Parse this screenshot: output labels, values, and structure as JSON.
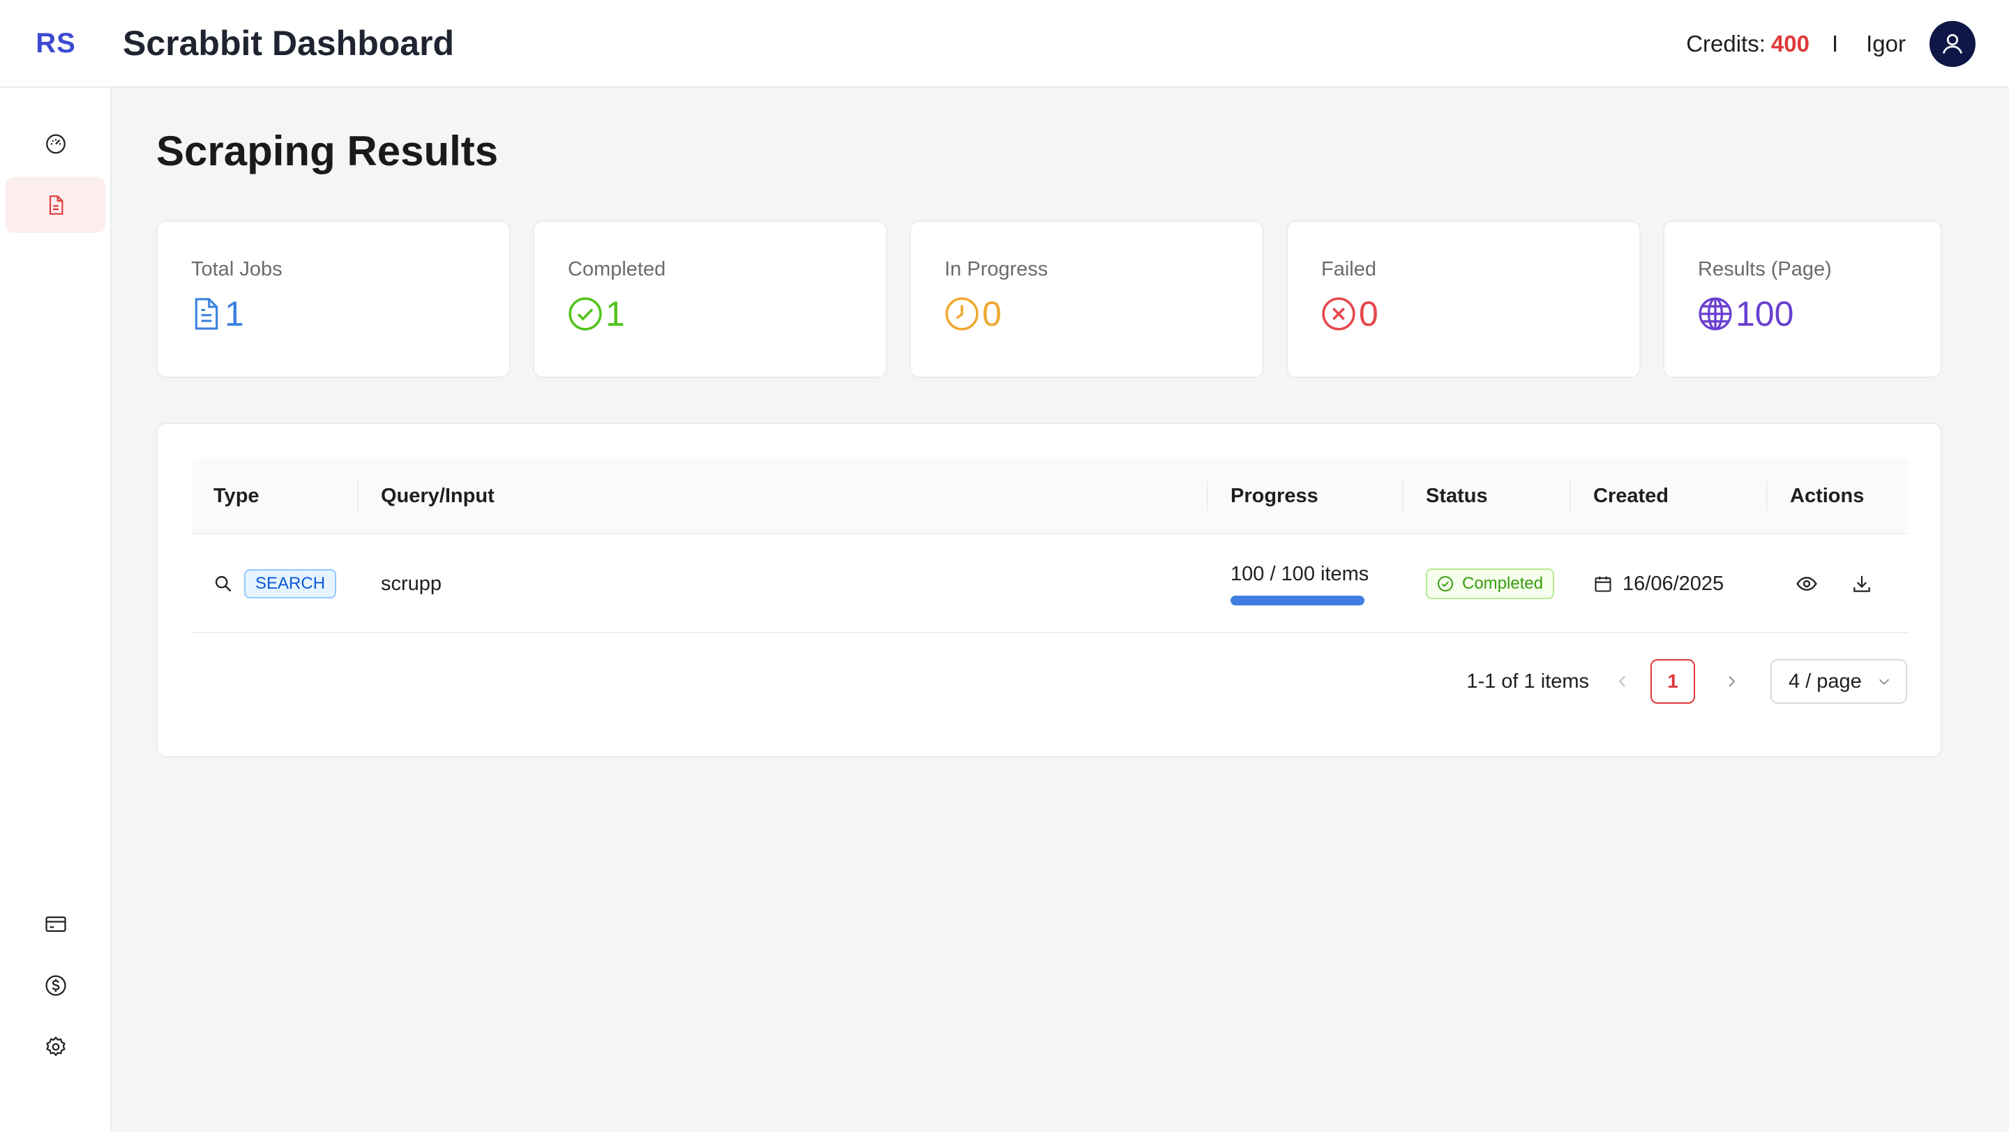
{
  "header": {
    "logo": "RS",
    "title": "Scrabbit Dashboard",
    "credits_label": "Credits:",
    "credits_value": "400",
    "separator": "I",
    "user_name": "Igor"
  },
  "sidebar": {
    "items": [
      {
        "icon": "dashboard-gauge-icon",
        "active": false
      },
      {
        "icon": "document-icon",
        "active": true
      },
      {
        "icon": "credit-card-icon",
        "active": false
      },
      {
        "icon": "dollar-circle-icon",
        "active": false
      },
      {
        "icon": "settings-gear-icon",
        "active": false
      }
    ]
  },
  "page": {
    "title": "Scraping Results"
  },
  "stats": [
    {
      "label": "Total Jobs",
      "value": "1",
      "icon": "document-icon",
      "color": "#3b82e0"
    },
    {
      "label": "Completed",
      "value": "1",
      "icon": "check-circle-icon",
      "color": "#52c41a"
    },
    {
      "label": "In Progress",
      "value": "0",
      "icon": "clock-icon",
      "color": "#f0a830"
    },
    {
      "label": "Failed",
      "value": "0",
      "icon": "close-circle-icon",
      "color": "#e5484d"
    },
    {
      "label": "Results (Page)",
      "value": "100",
      "icon": "globe-icon",
      "color": "#6a3fd1"
    }
  ],
  "table": {
    "columns": [
      "Type",
      "Query/Input",
      "Progress",
      "Status",
      "Created",
      "Actions"
    ],
    "rows": [
      {
        "type": "SEARCH",
        "query": "scrupp",
        "progress_text": "100 / 100 items",
        "progress": 1.0,
        "status": "Completed",
        "created": "16/06/2025"
      }
    ]
  },
  "pagination": {
    "summary": "1-1 of 1 items",
    "current_page": "1",
    "page_size": "4 / page"
  },
  "colors": {
    "accent": "#e03a3a",
    "brand": "#3d4bd1",
    "avatar_bg": "#0f1747"
  }
}
